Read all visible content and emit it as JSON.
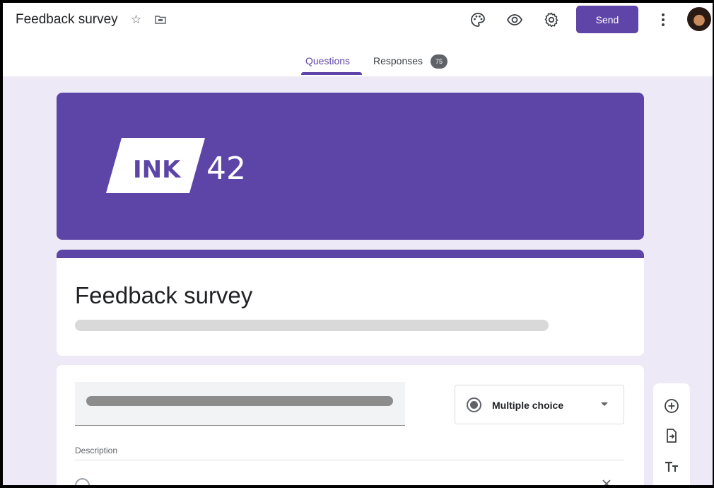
{
  "header": {
    "doc_title": "Feedback survey",
    "send_label": "Send",
    "icons": [
      "star-icon",
      "move-to-folder-icon",
      "palette-icon",
      "preview-eye-icon",
      "settings-gear-icon",
      "more-vert-icon"
    ]
  },
  "tabs": {
    "questions": "Questions",
    "responses": "Responses",
    "responses_count": "75",
    "active": "Questions"
  },
  "banner": {
    "logo_left": "INK",
    "logo_right": "42"
  },
  "form": {
    "title": "Feedback survey"
  },
  "question": {
    "type": "Multiple choice",
    "description_label": "Description"
  },
  "colors": {
    "accent": "#5d45a8",
    "background": "#ede9f6"
  }
}
